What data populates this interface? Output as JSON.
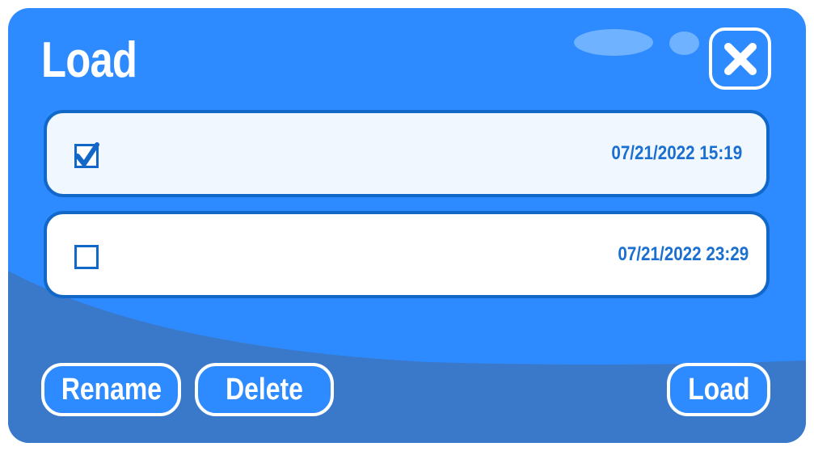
{
  "dialog": {
    "title": "Load",
    "close_icon": "close-x-icon",
    "colors": {
      "panel": "#2e8bff",
      "panel_shade": "#3a78c9",
      "accent_text": "#1a6fd0",
      "border": "#1268c9"
    }
  },
  "saves": [
    {
      "checked": true,
      "timestamp": "07/21/2022 15:19"
    },
    {
      "checked": false,
      "timestamp": "07/21/2022 23:29"
    }
  ],
  "buttons": {
    "rename": "Rename",
    "delete": "Delete",
    "load": "Load"
  }
}
